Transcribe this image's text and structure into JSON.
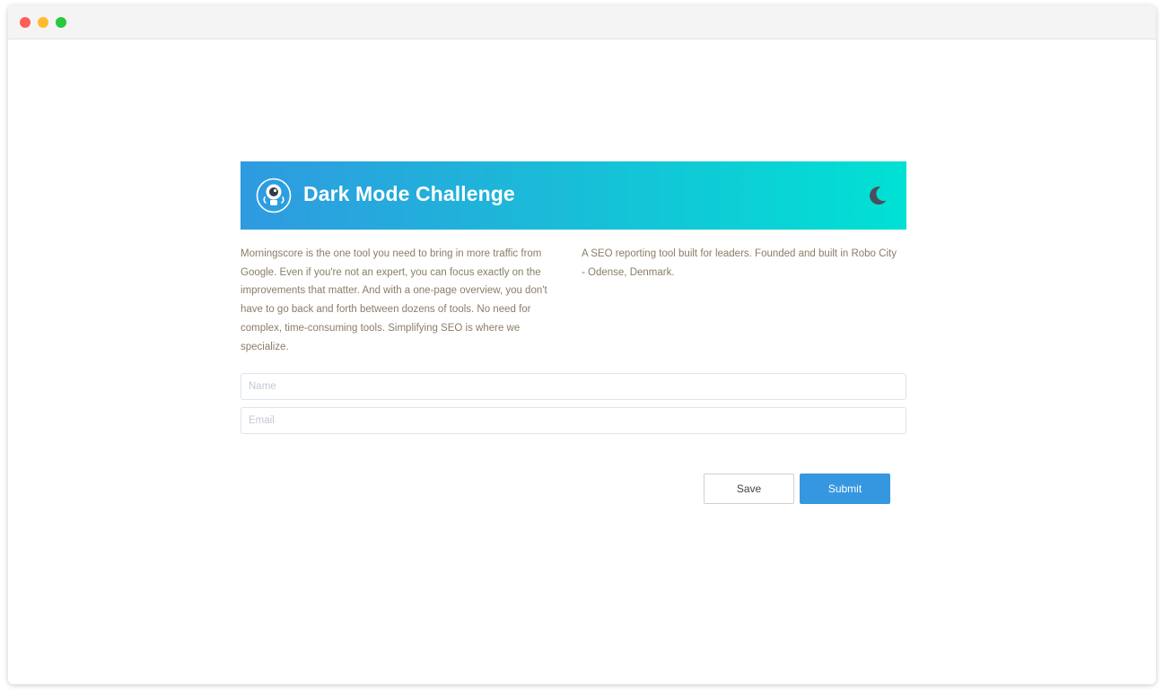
{
  "window": {
    "controls": [
      "close",
      "minimize",
      "maximize"
    ]
  },
  "banner": {
    "title": "Dark Mode Challenge",
    "logo_icon": "robot-logo-icon",
    "theme_toggle_icon": "moon-icon",
    "gradient_colors": [
      "#2f9ae0",
      "#1bbad8",
      "#00e1d4"
    ]
  },
  "content": {
    "left_text": "Morningscore is the one tool you need to bring in more traffic from Google. Even if you're not an expert, you can focus exactly on the improvements that matter. And with a one-page overview, you don't have to go back and forth between dozens of tools. No need for complex, time-consuming tools. Simplifying SEO is where we specialize.",
    "right_text": "A SEO reporting tool built for leaders. Founded and built in Robo City - Odense, Denmark."
  },
  "form": {
    "name_placeholder": "Name",
    "name_value": "",
    "email_placeholder": "Email",
    "email_value": ""
  },
  "buttons": {
    "save_label": "Save",
    "submit_label": "Submit",
    "submit_color": "#3597df"
  }
}
